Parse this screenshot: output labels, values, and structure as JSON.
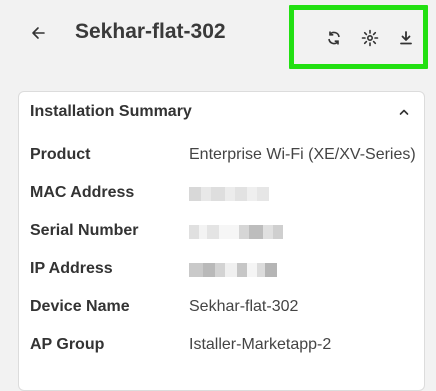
{
  "header": {
    "title": "Sekhar-flat-302",
    "back_icon": "arrow-left-icon",
    "actions": [
      {
        "name": "refresh-button",
        "icon": "sync-icon"
      },
      {
        "name": "reboot-button",
        "icon": "sun-burst-icon"
      },
      {
        "name": "download-button",
        "icon": "download-icon"
      }
    ],
    "highlight_color": "#22e012"
  },
  "summary": {
    "title": "Installation Summary",
    "rows": [
      {
        "label": "Product",
        "value": "Enterprise Wi-Fi (XE/XV-Series)"
      },
      {
        "label": "MAC Address",
        "value": ""
      },
      {
        "label": "Serial Number",
        "value": ""
      },
      {
        "label": "IP Address",
        "value": ""
      },
      {
        "label": "Device Name",
        "value": "Sekhar-flat-302"
      },
      {
        "label": "AP Group",
        "value": "Istaller-Marketapp-2"
      }
    ]
  }
}
